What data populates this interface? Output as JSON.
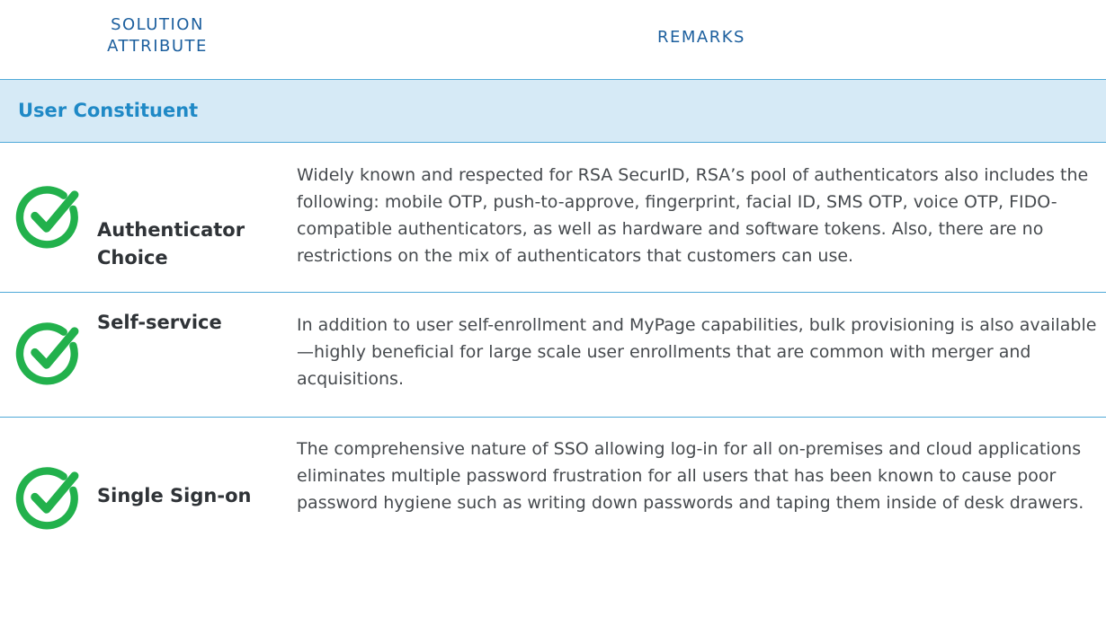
{
  "header": {
    "attribute_col_line1": "SOLUTION",
    "attribute_col_line2": "ATTRIBUTE",
    "remarks_col": "REMARKS"
  },
  "section": {
    "title": "User Constituent"
  },
  "rows": [
    {
      "attribute": "Authenticator Choice",
      "icon": "check-circle-icon",
      "remarks": "Widely known and respected for RSA SecurID, RSA’s pool of authenticators also includes the following: mobile OTP, push-to-approve, fingerprint, facial ID, SMS OTP, voice OTP, FIDO-compatible authenticators, as well as hardware and software tokens. Also, there are no restrictions on the mix of authenticators that customers can use."
    },
    {
      "attribute": "Self-service",
      "icon": "check-circle-icon",
      "remarks": "In addition to user self-enrollment and MyPage capabilities, bulk provisioning is also available—highly beneficial for large scale user enrollments that are common with merger and acquisitions."
    },
    {
      "attribute": "Single Sign-on",
      "icon": "check-circle-icon",
      "remarks": "The comprehensive nature of SSO allowing log-in for all on-premises and cloud applications eliminates multiple password frustration for all users that has been known to cause poor password hygiene such as writing down passwords and taping them inside of desk drawers."
    }
  ],
  "colors": {
    "header_text": "#1c5f9e",
    "section_text": "#1f89c6",
    "section_bg": "#d6eaf6",
    "divider": "#4fa9d8",
    "check_green": "#22b14c"
  }
}
